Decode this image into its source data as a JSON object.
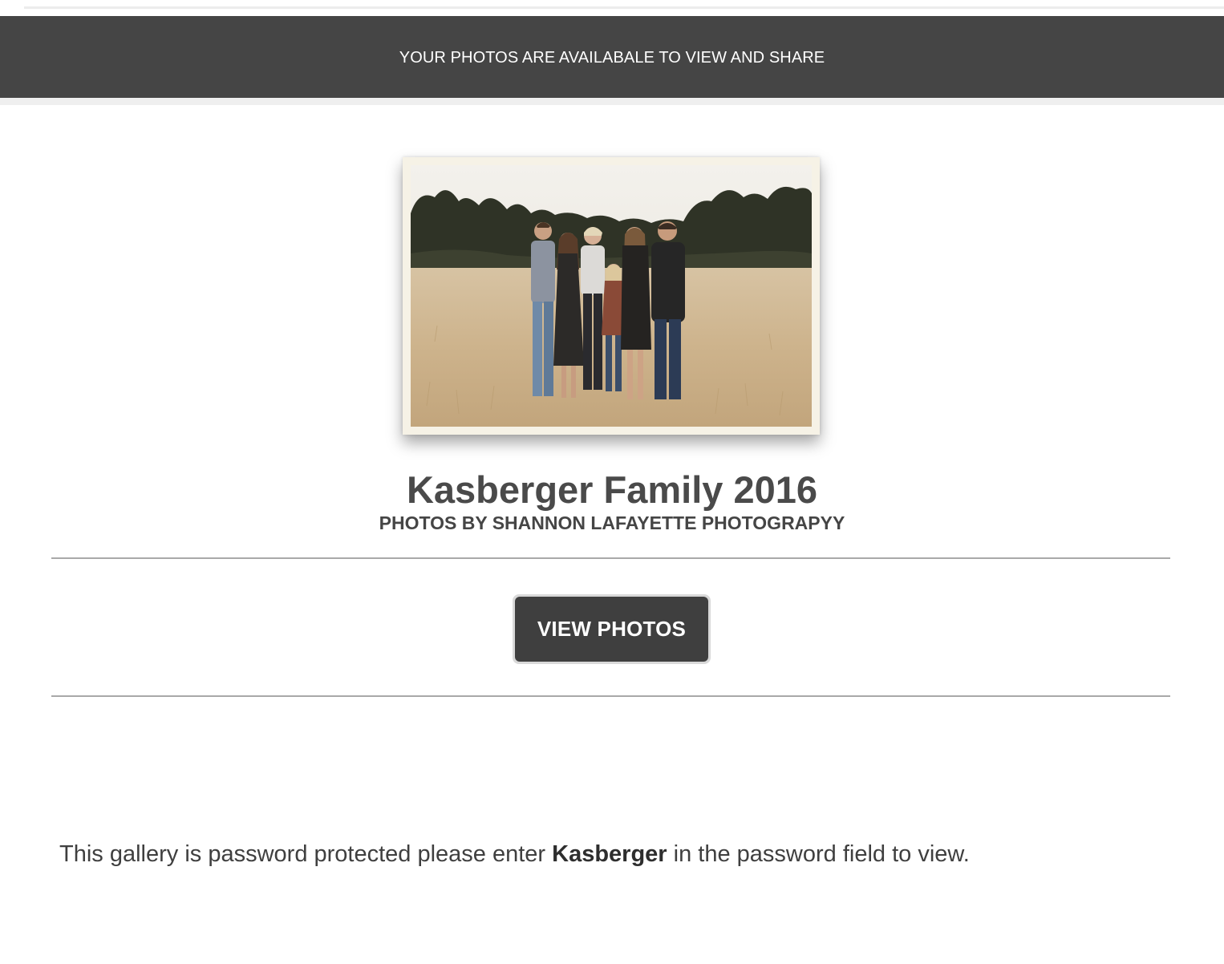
{
  "banner": {
    "text": "YOUR PHOTOS ARE AVAILABALE TO VIEW AND SHARE"
  },
  "gallery": {
    "title": "Kasberger Family 2016",
    "subtitle": "PHOTOS BY SHANNON LAFAYETTE PHOTOGRAPYY",
    "button_label": "VIEW PHOTOS"
  },
  "notice": {
    "before": "This gallery is password protected please enter ",
    "password": "Kasberger",
    "after": " in the password field to view."
  },
  "colors": {
    "banner_bg": "#454545",
    "button_bg": "#3f3f3f",
    "frame": "#f6f2e6",
    "divider": "#a9a9a9"
  }
}
